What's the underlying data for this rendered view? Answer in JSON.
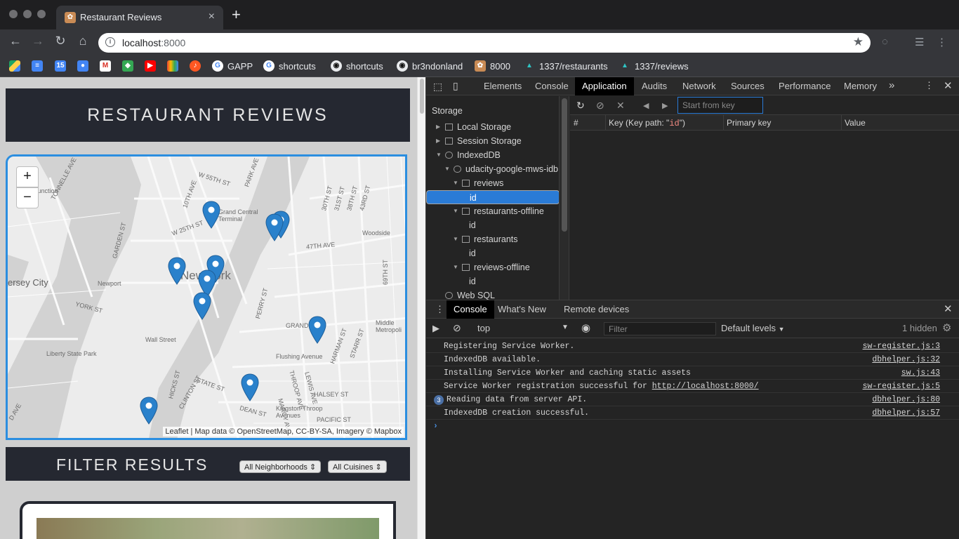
{
  "browser": {
    "tab_title": "Restaurant Reviews",
    "tab_close": "×",
    "new_tab": "+",
    "url_host": "localhost",
    "url_port": ":8000",
    "bookmarks": [
      "GAPP",
      "shortcuts",
      "shortcuts",
      "br3ndonland",
      "8000",
      "1337/restaurants",
      "1337/reviews"
    ]
  },
  "page": {
    "title": "RESTAURANT REVIEWS",
    "map": {
      "zoom_in": "+",
      "zoom_out": "−",
      "labels": [
        "Junction",
        "TONNELLE AVE",
        "GARDEN ST",
        "W 55TH ST",
        "10TH AVE",
        "W 25TH ST",
        "Grand Central Terminal",
        "PARK AVE",
        "47TH AVE",
        "Woodside",
        "30TH ST",
        "31ST ST",
        "38TH ST",
        "43RD ST",
        "ersey City",
        "Newport",
        "New York",
        "YORK ST",
        "Wall Street",
        "PERRY ST",
        "GRAND ST",
        "Flushing Avenue",
        "Liberty State Park",
        "MARCY AVE",
        "LEWIS AVE",
        "HALSEY ST",
        "HARMAN ST",
        "STARR ST",
        "Kingston-Throop Avenues",
        "DEAN ST",
        "PACIFIC ST",
        "CLINTON ST",
        "STATE ST",
        "HICKS ST",
        "THROOP AVE",
        "Middle Metropoli",
        "69TH ST",
        "D AVE"
      ],
      "attribution": "Leaflet | Map data © OpenStreetMap, CC-BY-SA, Imagery © Mapbox"
    },
    "filter": {
      "title": "FILTER RESULTS",
      "neighborhoods": "All Neighborhoods",
      "cuisines": "All Cuisines"
    }
  },
  "devtools": {
    "tabs": [
      "Elements",
      "Console",
      "Application",
      "Audits",
      "Network",
      "Sources",
      "Performance",
      "Memory"
    ],
    "active_tab": "Application",
    "more": "»",
    "storage_heading": "Storage",
    "tree": [
      {
        "label": "Local Storage"
      },
      {
        "label": "Session Storage"
      },
      {
        "label": "IndexedDB"
      },
      {
        "label": "udacity-google-mws-idb"
      },
      {
        "label": "reviews"
      },
      {
        "label": "id"
      },
      {
        "label": "restaurants-offline"
      },
      {
        "label": "id"
      },
      {
        "label": "restaurants"
      },
      {
        "label": "id"
      },
      {
        "label": "reviews-offline"
      },
      {
        "label": "id"
      },
      {
        "label": "Web SQL"
      }
    ],
    "start_key_placeholder": "Start from key",
    "columns": {
      "num": "#",
      "key_pre": "Key (Key path: \"",
      "key_path": "id",
      "key_post": "\")",
      "primary": "Primary key",
      "value": "Value"
    },
    "drawer_tabs": [
      "Console",
      "What's New",
      "Remote devices"
    ],
    "context": "top",
    "filter_placeholder": "Filter",
    "levels": "Default levels",
    "hidden": "1 hidden",
    "messages": [
      {
        "text": "Registering Service Worker.",
        "source": "sw-register.js:3"
      },
      {
        "text": "IndexedDB available.",
        "source": "dbhelper.js:32"
      },
      {
        "text": "Installing Service Worker and caching static assets",
        "source": "sw.js:43"
      },
      {
        "text": "Service Worker registration successful for ",
        "link": "http://localhost:8000/",
        "source": "sw-register.js:5"
      },
      {
        "text": "Reading data from server API.",
        "source": "dbhelper.js:80",
        "count": "3"
      },
      {
        "text": "IndexedDB creation successful.",
        "source": "dbhelper.js:57"
      }
    ],
    "prompt": "›"
  },
  "colors": {
    "accent": "#2b8ee0",
    "header_bg": "#252831",
    "selection": "#2a7bd6"
  }
}
